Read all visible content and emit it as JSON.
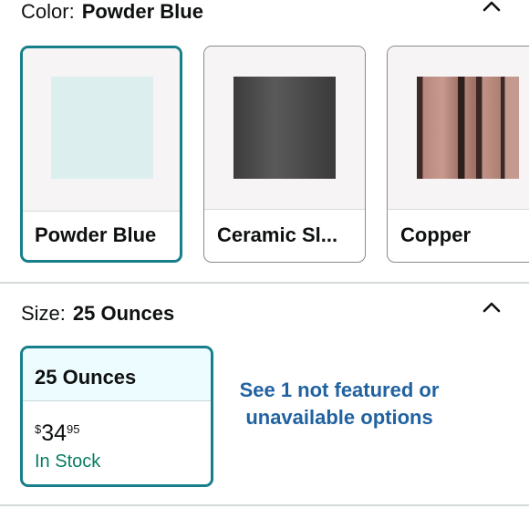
{
  "color": {
    "label": "Color:",
    "selected": "Powder Blue",
    "options": [
      {
        "name": "Powder Blue",
        "swatch_color": "#dcefee",
        "selected": true
      },
      {
        "name": "Ceramic Sl...",
        "swatch_color": "#4a4a4a",
        "selected": false
      },
      {
        "name": "Copper",
        "swatch_color": "#b8877c",
        "selected": false
      }
    ]
  },
  "size": {
    "label": "Size:",
    "selected": "25 Ounces",
    "options": [
      {
        "name": "25 Ounces",
        "currency": "$",
        "price_whole": "34",
        "price_fraction": "95",
        "availability": "In Stock",
        "selected": true
      }
    ],
    "see_more": "See 1 not featured or unavailable options"
  },
  "colors": {
    "accent": "#177f8a",
    "link": "#2162a1",
    "in_stock": "#067d62",
    "selected_bg": "#edfdff"
  },
  "icons": {
    "color_toggle": "chevron-up-icon",
    "size_toggle": "chevron-up-icon"
  }
}
